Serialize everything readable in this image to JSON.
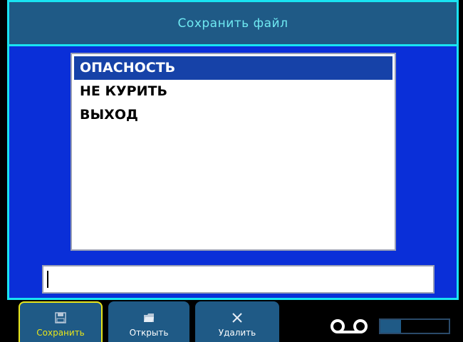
{
  "dialog": {
    "title": "Сохранить файл"
  },
  "files": [
    {
      "name": "ОПАСНОСТЬ",
      "selected": true
    },
    {
      "name": "НЕ КУРИТЬ",
      "selected": false
    },
    {
      "name": "ВЫХОД",
      "selected": false
    }
  ],
  "name_input": {
    "value": ""
  },
  "softkeys": {
    "save": {
      "label": "Сохранить",
      "icon": "save-icon",
      "active": true
    },
    "open": {
      "label": "Открыть",
      "icon": "folder-icon",
      "active": false
    },
    "delete": {
      "label": "Удалить",
      "icon": "close-icon",
      "active": false
    }
  },
  "status": {
    "icon": "tape-icon",
    "level_fraction": 0.3
  },
  "colors": {
    "accent": "#19e3f2",
    "background": "#0a2fd8",
    "selection": "#1642a8",
    "active_key": "#e9e61a"
  }
}
